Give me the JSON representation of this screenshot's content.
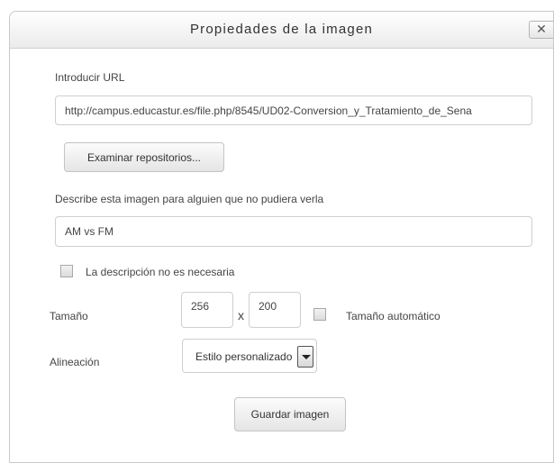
{
  "dialog": {
    "title": "Propiedades de la imagen",
    "close_label": "✕"
  },
  "url_section": {
    "label": "Introducir URL",
    "value": "http://campus.educastur.es/file.php/8545/UD02-Conversion_y_Tratamiento_de_Sena",
    "browse_button": "Examinar repositorios..."
  },
  "description_section": {
    "label": "Describe esta imagen para alguien que no pudiera verla",
    "value": "AM vs FM",
    "not_needed_label": "La descripción no es necesaria"
  },
  "size": {
    "label": "Tamaño",
    "width": "256",
    "separator": "x",
    "height": "200",
    "auto_label": "Tamaño automático"
  },
  "alignment": {
    "label": "Alineación",
    "selected": "Estilo personalizado"
  },
  "save_button": "Guardar imagen"
}
